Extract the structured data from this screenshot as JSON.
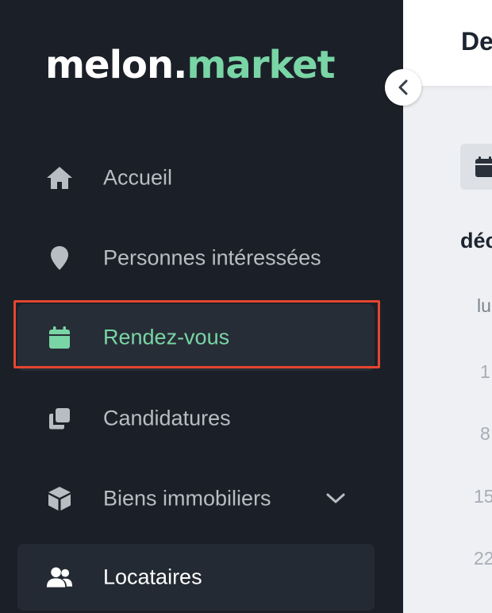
{
  "brand": {
    "part1": "melon.",
    "part2": "market",
    "accent": "#79d5a5"
  },
  "sidebar": {
    "items": [
      {
        "label": "Accueil",
        "icon": "home-icon"
      },
      {
        "label": "Personnes intéressées",
        "icon": "map-pin-icon"
      },
      {
        "label": "Rendez-vous",
        "icon": "calendar-icon",
        "active": true
      },
      {
        "label": "Candidatures",
        "icon": "copy-icon"
      },
      {
        "label": "Biens immobiliers",
        "icon": "box-icon",
        "expandable": true
      },
      {
        "label": "Locataires",
        "icon": "users-icon",
        "current": true
      }
    ]
  },
  "header": {
    "title": "De"
  },
  "calendar": {
    "month": "déc",
    "weekday": "lu",
    "days": [
      "1",
      "8",
      "15",
      "22"
    ]
  },
  "colors": {
    "sidebar_bg": "#1b2028",
    "highlight": "#e5452f"
  }
}
